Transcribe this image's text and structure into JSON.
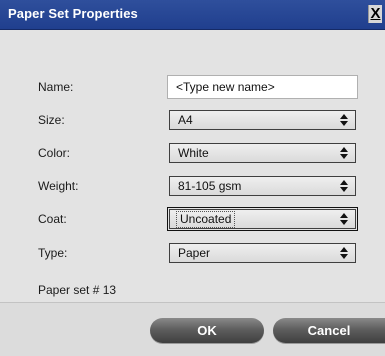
{
  "window": {
    "title": "Paper Set Properties",
    "close_label": "X"
  },
  "form": {
    "name_label": "Name:",
    "name_value": "<Type new name>",
    "size_label": "Size:",
    "size_value": "A4",
    "color_label": "Color:",
    "color_value": "White",
    "weight_label": "Weight:",
    "weight_value": "81-105 gsm",
    "coat_label": "Coat:",
    "coat_value": "Uncoated",
    "type_label": "Type:",
    "type_value": "Paper",
    "paper_set_info": "Paper set # 13"
  },
  "buttons": {
    "ok_label": "OK",
    "cancel_label": "Cancel"
  },
  "icons": {
    "dropdown_arrow": "up-down-arrows-icon",
    "close": "close-icon"
  },
  "colors": {
    "title_bar": "#233f8f",
    "dialog_bg": "#e3e3e3",
    "button_bg": "#5e5e5e"
  }
}
